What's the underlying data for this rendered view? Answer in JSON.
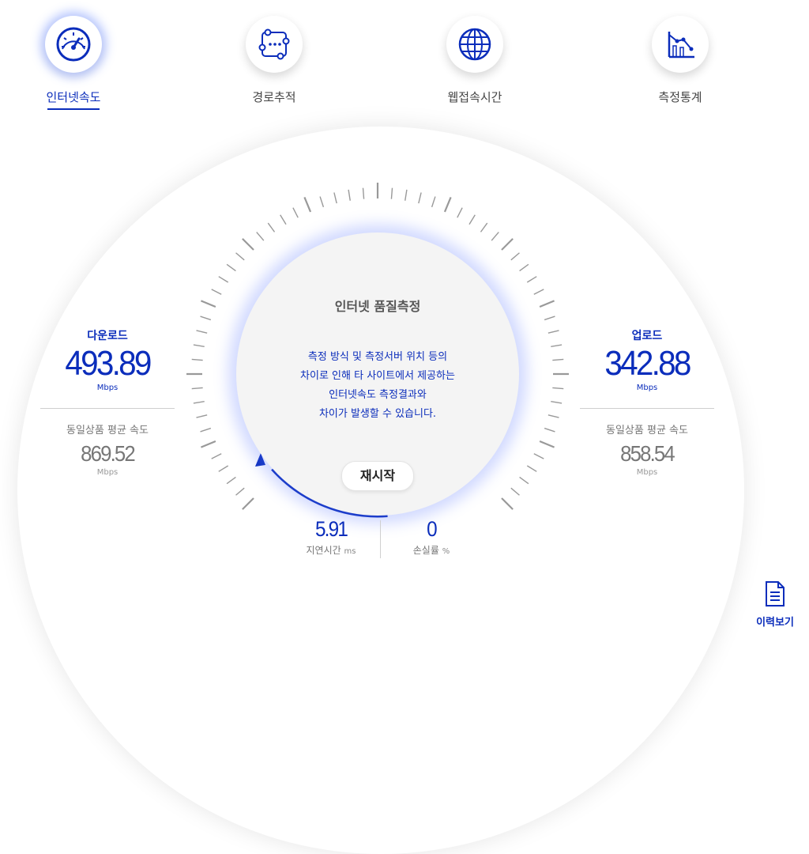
{
  "nav": {
    "items": [
      {
        "label": "인터넷속도",
        "icon": "speedometer-icon",
        "active": true
      },
      {
        "label": "경로추적",
        "icon": "route-trace-icon",
        "active": false
      },
      {
        "label": "웹접속시간",
        "icon": "globe-icon",
        "active": false
      },
      {
        "label": "측정통계",
        "icon": "statistics-icon",
        "active": false
      }
    ]
  },
  "download": {
    "title": "다운로드",
    "value": "493.89",
    "unit": "Mbps",
    "avg_label": "동일상품 평균 속도",
    "avg_value": "869.52",
    "avg_unit": "Mbps"
  },
  "upload": {
    "title": "업로드",
    "value": "342.88",
    "unit": "Mbps",
    "avg_label": "동일상품 평균 속도",
    "avg_value": "858.54",
    "avg_unit": "Mbps"
  },
  "center": {
    "title": "인터넷 품질측정",
    "message_lines": [
      "측정 방식 및 측정서버 위치 등의",
      "차이로 인해 타 사이트에서 제공하는",
      "인터넷속도 측정결과와",
      "차이가 발생할 수 있습니다."
    ],
    "restart_label": "재시작"
  },
  "latency": {
    "value": "5.91",
    "label": "지연시간",
    "unit": "ms"
  },
  "loss": {
    "value": "0",
    "label": "손실률",
    "unit": "%"
  },
  "history": {
    "label": "이력보기",
    "icon": "document-icon"
  },
  "colors": {
    "accent": "#0b2dbb",
    "glow": "#5a78ff",
    "tick": "#999999"
  }
}
